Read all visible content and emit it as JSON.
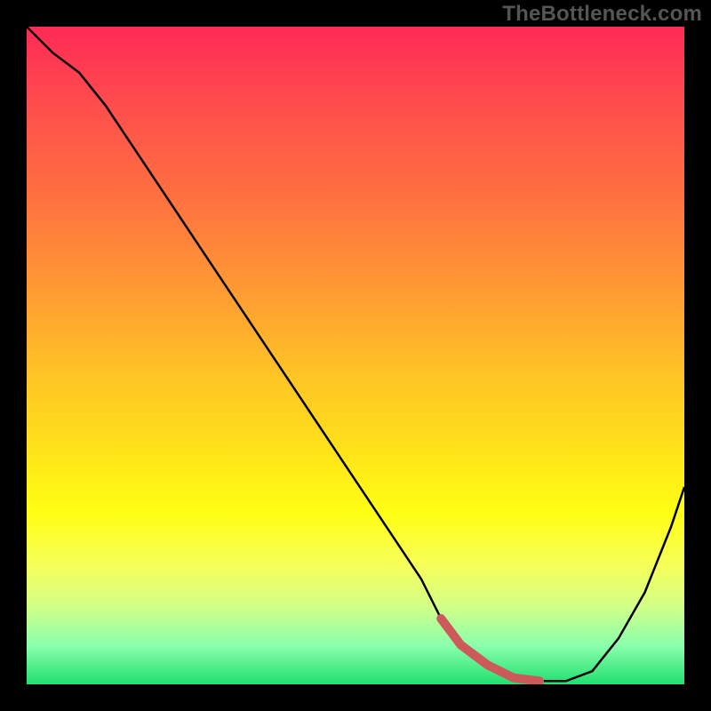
{
  "attribution": "TheBottleneck.com",
  "chart_data": {
    "type": "line",
    "title": "",
    "xlabel": "",
    "ylabel": "",
    "xlim": [
      0,
      100
    ],
    "ylim": [
      0,
      100
    ],
    "x": [
      0,
      4,
      8,
      12,
      16,
      20,
      24,
      28,
      32,
      36,
      40,
      44,
      48,
      52,
      56,
      60,
      63,
      66,
      70,
      74,
      78,
      82,
      86,
      90,
      94,
      98,
      100
    ],
    "values": [
      100,
      96,
      93,
      88,
      82,
      76,
      70,
      64,
      58,
      52,
      46,
      40,
      34,
      28,
      22,
      16,
      10,
      6,
      3,
      1,
      0.5,
      0.5,
      2,
      7,
      14,
      24,
      30
    ],
    "highlight_x_range": [
      63,
      80
    ],
    "gradient_stops": [
      {
        "pos": 0.0,
        "color": "#ff2a55"
      },
      {
        "pos": 0.12,
        "color": "#ff4d4d"
      },
      {
        "pos": 0.26,
        "color": "#ff7140"
      },
      {
        "pos": 0.4,
        "color": "#ff9a33"
      },
      {
        "pos": 0.52,
        "color": "#ffc126"
      },
      {
        "pos": 0.64,
        "color": "#ffe11a"
      },
      {
        "pos": 0.74,
        "color": "#ffff14"
      },
      {
        "pos": 0.82,
        "color": "#f6ff5a"
      },
      {
        "pos": 0.88,
        "color": "#d4ff87"
      },
      {
        "pos": 0.94,
        "color": "#8cffad"
      },
      {
        "pos": 1.0,
        "color": "#20e070"
      }
    ]
  }
}
